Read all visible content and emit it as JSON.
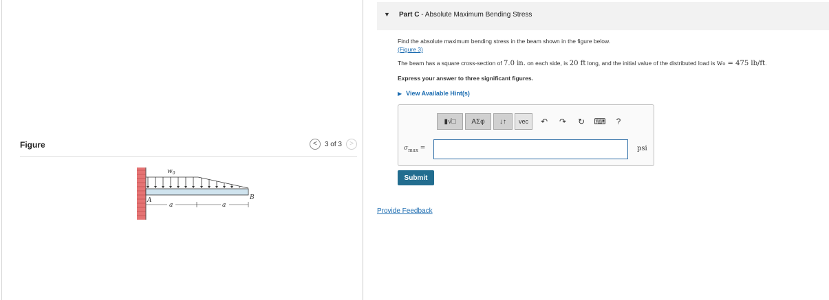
{
  "figure_panel": {
    "title": "Figure",
    "pager_text": "3 of 3",
    "prev_symbol": "<",
    "next_symbol": ">",
    "beam_labels": {
      "load": "w",
      "load_sub": "0",
      "left_end": "A",
      "right_end": "B",
      "span1": "a",
      "span2": "a"
    }
  },
  "part": {
    "caret": "▼",
    "label": "Part C",
    "separator": " - ",
    "title": "Absolute Maximum Bending Stress"
  },
  "question": {
    "line1": "Find the absolute maximum bending stress in the beam shown in the figure below.",
    "figure_link": "(Figure 3)",
    "line2_a": "The beam has a square cross-section of ",
    "line2_b": "7.0 in.",
    "line2_c": " on each side, is ",
    "line2_d": "20 ft",
    "line2_e": " long, and the initial value of the distributed load is ",
    "line2_f": "w₀ = 475 lb/ft",
    "line2_g": ".",
    "instruction": "Express your answer to three significant figures.",
    "hints_label": "View Available Hint(s)"
  },
  "answer": {
    "toolbar": {
      "templates": "▮√□",
      "greek": "ΑΣφ",
      "arrows": "↓↑",
      "vec": "vec",
      "undo": "↶",
      "redo": "↷",
      "reset": "↻",
      "keyboard": "⌨",
      "help": "?"
    },
    "variable": "σ",
    "variable_sub": "max",
    "equals": "=",
    "value": "",
    "unit": "psi"
  },
  "submit_label": "Submit",
  "feedback_label": "Provide Feedback",
  "colors": {
    "link": "#1a6bb0",
    "submit_bg": "#226d8f",
    "beam_fill": "#cfe3ee",
    "wall": "#e57373"
  }
}
